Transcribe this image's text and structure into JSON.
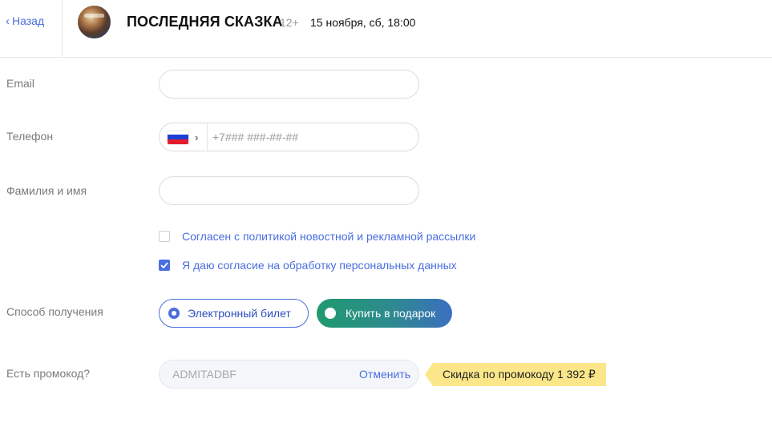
{
  "header": {
    "back_label": "Назад",
    "title": "ПОСЛЕДНЯЯ СКАЗКА",
    "age_rating": "12+",
    "datetime": "15 ноября, сб, 18:00"
  },
  "form": {
    "email_label": "Email",
    "email_value": "",
    "phone_label": "Телефон",
    "phone_placeholder": "+7### ###-##-##",
    "phone_country_icon": "russia-flag-icon",
    "name_label": "Фамилия и имя",
    "name_value": ""
  },
  "consents": [
    {
      "text": "Согласен с политикой новостной и рекламной рассылки",
      "checked": false
    },
    {
      "text": "Я даю согласие на обработку персональных данных",
      "checked": true
    }
  ],
  "delivery": {
    "label": "Способ получения",
    "options": [
      {
        "label": "Электронный билет",
        "selected": true
      },
      {
        "label": "Купить в подарок",
        "selected": false
      }
    ]
  },
  "promo": {
    "label": "Есть промокод?",
    "code": "ADMITADBF",
    "cancel_label": "Отменить",
    "discount_text": "Скидка по промокоду 1 392 ₽"
  },
  "colors": {
    "accent": "#4a6ee0",
    "gift_gradient_start": "#1f9a6e",
    "gift_gradient_end": "#3b6fc0",
    "discount_bg": "#fbe789"
  }
}
